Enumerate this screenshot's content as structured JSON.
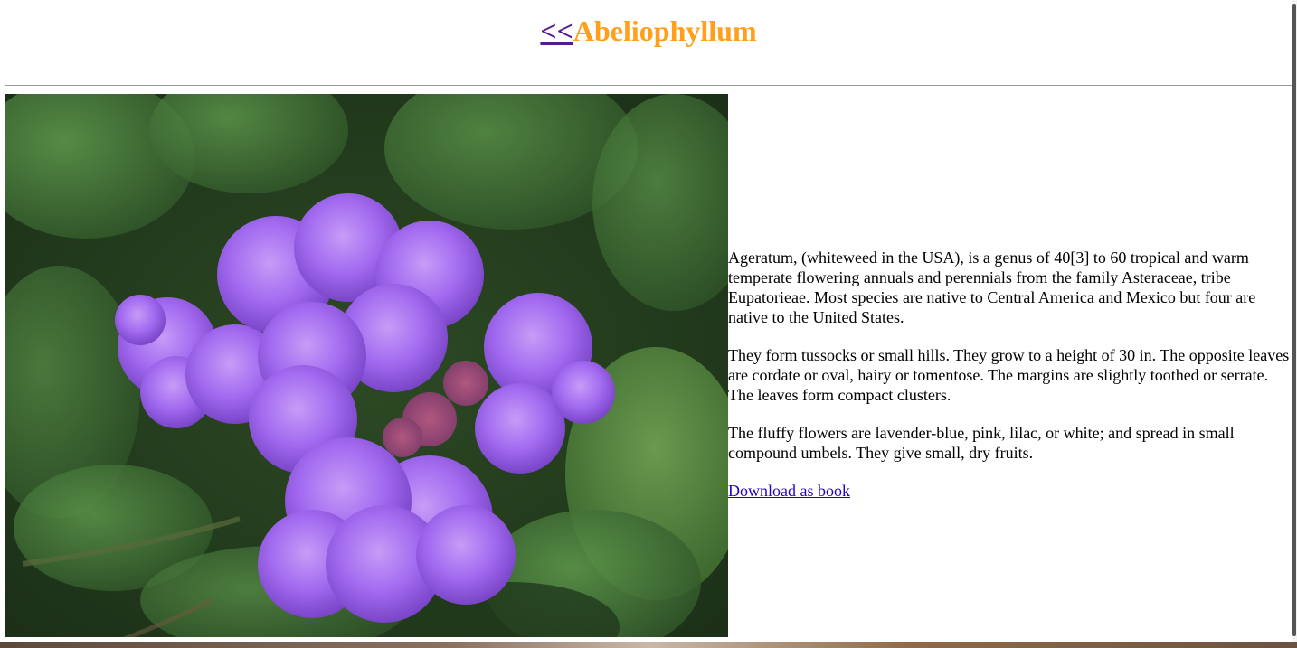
{
  "header": {
    "back_label": "<<",
    "title": "Abeliophyllum"
  },
  "image": {
    "alt": "purple ageratum flower cluster among green leaves",
    "colors": {
      "flower": "#a36bf0",
      "foliage": "#3d6b33"
    }
  },
  "content": {
    "paragraphs": [
      "Ageratum, (whiteweed in the USA), is a genus of 40[3] to 60 tropical and warm temperate flowering annuals and perennials from the family Asteraceae, tribe Eupatorieae. Most species are native to Central America and Mexico but four are native to the United States.",
      "They form tussocks or small hills. They grow to a height of 30 in. The opposite leaves are cordate or oval, hairy or tomentose. The margins are slightly toothed or serrate. The leaves form compact clusters.",
      "The fluffy flowers are lavender-blue, pink, lilac, or white; and spread in small compound umbels. They give small, dry fruits."
    ],
    "download_label": "Download as book"
  },
  "colors": {
    "title": "#ff9f1a",
    "back_link": "#551a8b",
    "download_link": "#2200cc"
  }
}
